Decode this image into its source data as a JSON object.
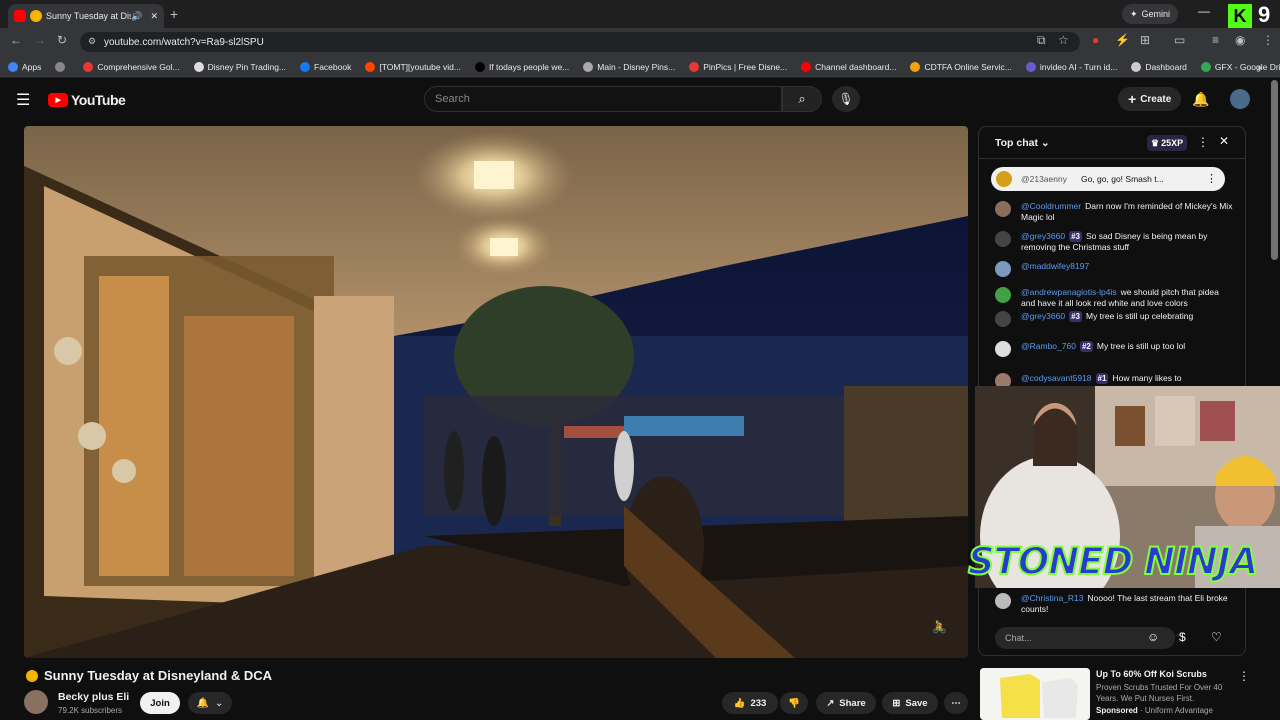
{
  "browser": {
    "tab_title": "Sunny Tuesday at Disne",
    "url": "youtube.com/watch?v=Ra9-sl2lSPU",
    "gemini_label": "Gemini",
    "kick_count": "9",
    "bookmarks": [
      {
        "label": "Apps",
        "color": "#4285f4"
      },
      {
        "label": "",
        "color": "#888888"
      },
      {
        "label": "Comprehensive Gol...",
        "color": "#e53935"
      },
      {
        "label": "Disney Pin Trading...",
        "color": "#dddddd"
      },
      {
        "label": "Facebook",
        "color": "#1877f2"
      },
      {
        "label": "[TOMT][youtube vid...",
        "color": "#ff4500"
      },
      {
        "label": "If todays people we...",
        "color": "#000000"
      },
      {
        "label": "Main - Disney Pins...",
        "color": "#aaaaaa"
      },
      {
        "label": "PinPics | Free Disne...",
        "color": "#e53935"
      },
      {
        "label": "Channel dashboard...",
        "color": "#ff0000"
      },
      {
        "label": "CDTFA Online Servic...",
        "color": "#f4a20b"
      },
      {
        "label": "invideo AI - Turn id...",
        "color": "#6a5acd"
      },
      {
        "label": "Dashboard",
        "color": "#cccccc"
      },
      {
        "label": "GFX - Google Drive",
        "color": "#34a853"
      }
    ]
  },
  "youtube": {
    "logo_text": "YouTube",
    "search_placeholder": "Search",
    "create_label": "Create"
  },
  "video": {
    "title": "Sunny Tuesday at Disneyland & DCA",
    "channel_name": "Becky plus Eli",
    "subscribers": "79.2K subscribers",
    "join_label": "Join",
    "likes": "233",
    "share_label": "Share",
    "save_label": "Save"
  },
  "chat": {
    "header": "Top chat",
    "xp": "25XP",
    "pinned_author": "@213aenny",
    "pinned_text": "Go, go, go! Smash t...",
    "input_placeholder": "Chat...",
    "messages": [
      {
        "author": "@Cooldrummer",
        "badge": "",
        "text": "Darn now I'm reminded of Mickey's Mix Magic lol",
        "color": "#8a6d5a"
      },
      {
        "author": "@grey3660",
        "badge": "#3",
        "text": "So sad Disney is being mean by removing the Christmas stuff",
        "color": "#444444"
      },
      {
        "author": "@maddwifey8197",
        "badge": "",
        "text": "",
        "color": "#7a9ac0"
      },
      {
        "author": "@andrewpanagiotis-lp4is",
        "badge": "",
        "text": "we should pitch that pidea and have it all look red white and love colors",
        "color": "#43a047"
      },
      {
        "author": "@grey3660",
        "badge": "#3",
        "text": "My tree is still up celebrating",
        "color": "#444444"
      },
      {
        "author": "@Rambo_760",
        "badge": "#2",
        "text": "My tree is still up too lol",
        "color": "#dddddd"
      },
      {
        "author": "@codysavant5918",
        "badge": "#1",
        "text": "How many likes to",
        "color": "#9a7a6a"
      },
      {
        "author": "@Christina_R13",
        "badge": "",
        "text": "Noooo! The last stream that Eli broke counts!",
        "color": "#bbbbbb"
      }
    ]
  },
  "overlay": {
    "brand_text": "STONED NINJA"
  },
  "ad": {
    "title": "Up To 60% Off Koi Scrubs",
    "description": "Proven Scrubs Trusted For Over 40 Years. We Put Nurses First.",
    "sponsored": "Sponsored",
    "advertiser": "Uniform Advantage"
  }
}
